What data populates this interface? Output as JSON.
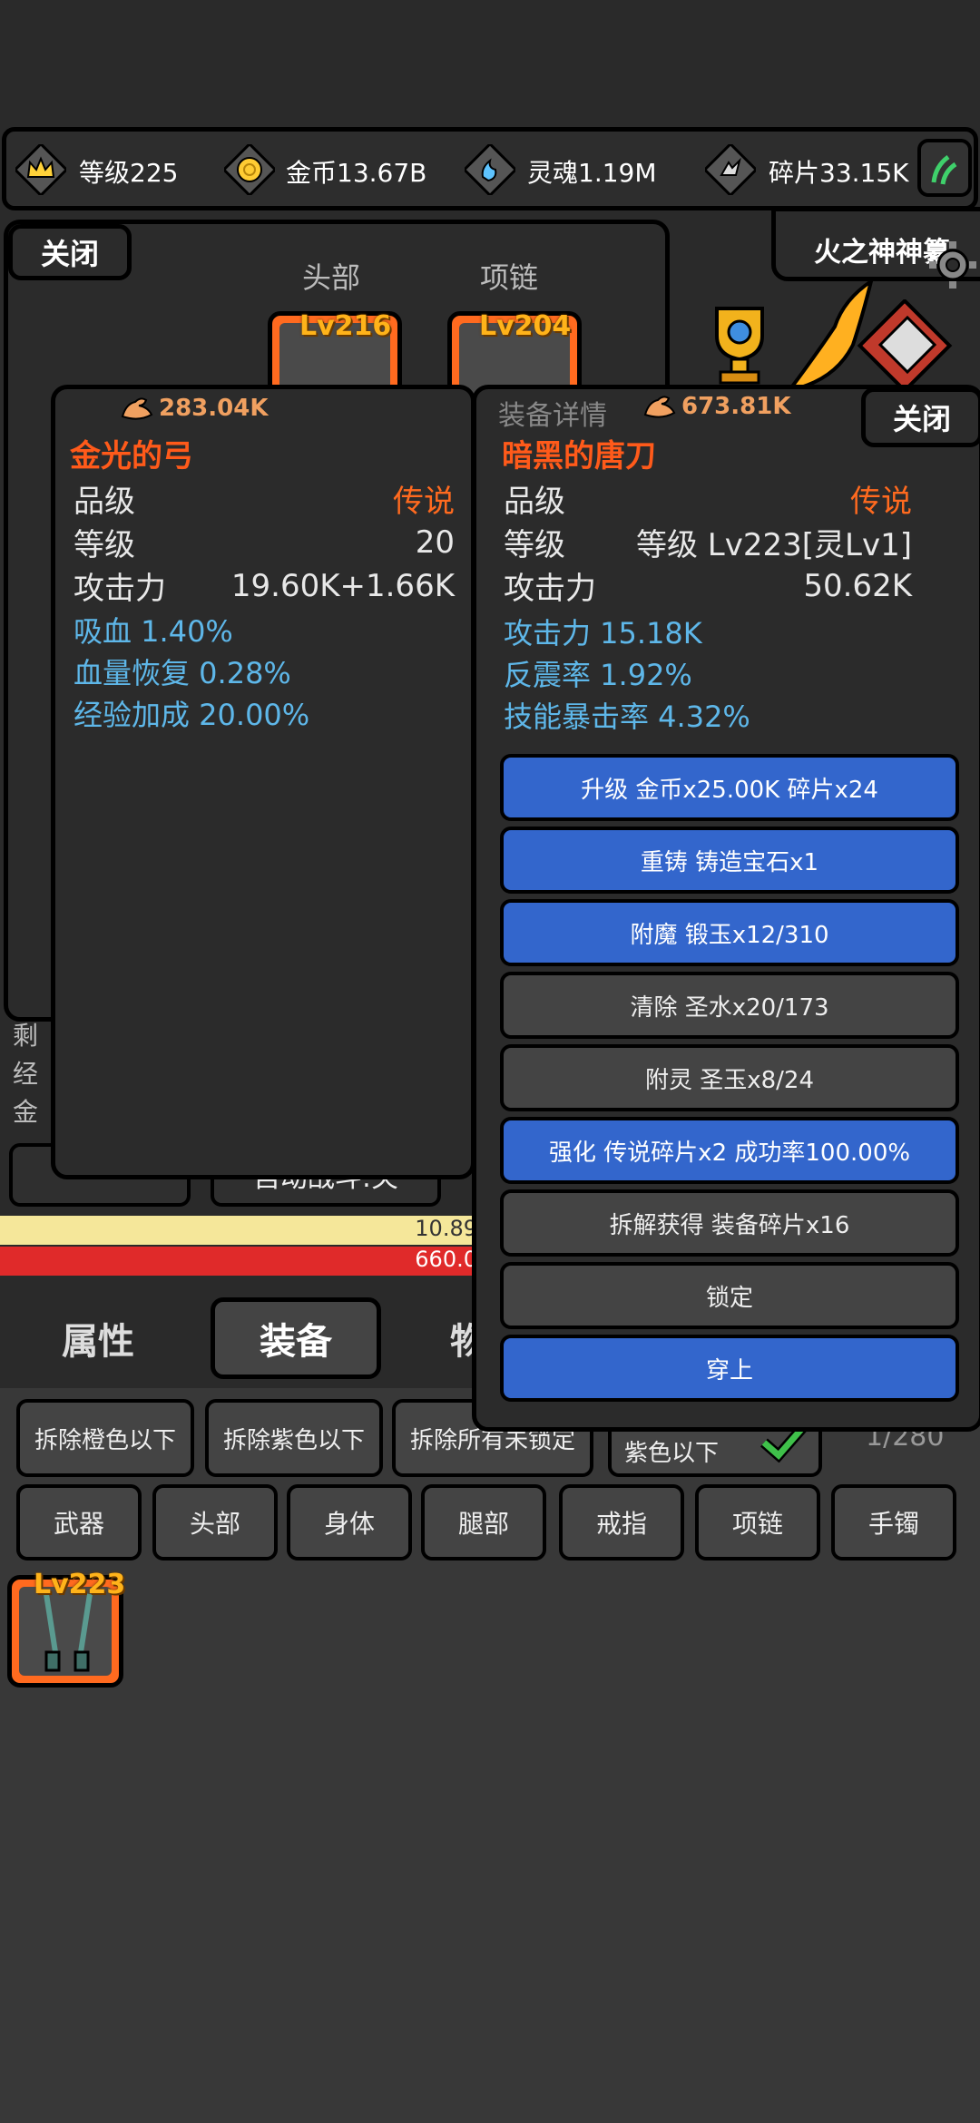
{
  "topbar": {
    "level": "等级225",
    "gold": "金币13.67B",
    "soul": "灵魂1.19M",
    "shards": "碎片33.15K"
  },
  "behind": {
    "close_label": "关闭",
    "slot_head_label": "头部",
    "slot_necklace_label": "项链",
    "slot_head_lv": "Lv216",
    "slot_necklace_lv": "Lv204",
    "fire_god_label": "火之神神纂",
    "left_text": [
      "剩",
      "经",
      "金"
    ],
    "power_yellow": "10.89",
    "power_red": "660.0",
    "btn_left_1": "",
    "btn_left_2": "自动战斗:关"
  },
  "tabs": {
    "attributes": "属性",
    "equipment": "装备",
    "partial": "物"
  },
  "filters": {
    "dismantle_orange": "拆除橙色以下",
    "dismantle_purple": "拆除紫色以下",
    "dismantle_unlocked": "拆除所有未锁定",
    "auto_purple": "紫色以下",
    "count": "1/280"
  },
  "categories": [
    "武器",
    "头部",
    "身体",
    "腿部",
    "戒指",
    "项链",
    "手镯"
  ],
  "inventory": [
    {
      "lv": "Lv223"
    }
  ],
  "compare_card": {
    "power": "283.04K",
    "name": "金光的弓",
    "rows": [
      {
        "label": "品级",
        "value": "传说"
      },
      {
        "label": "等级",
        "value": "20"
      },
      {
        "label": "攻击力",
        "value": "19.60K+1.66K"
      }
    ],
    "stats": [
      "吸血 1.40%",
      "血量恢复 0.28%",
      "经验加成 20.00%"
    ]
  },
  "detail_card": {
    "header": "装备详情",
    "power": "673.81K",
    "close_label": "关闭",
    "name": "暗黑的唐刀",
    "rows": [
      {
        "label": "品级",
        "value": "传说"
      },
      {
        "label": "等级",
        "value": "等级 Lv223[灵Lv1]"
      },
      {
        "label": "攻击力",
        "value": "50.62K"
      }
    ],
    "stats": [
      "攻击力 15.18K",
      "反震率 1.92%",
      "技能暴击率 4.32%"
    ],
    "actions": [
      {
        "label": "升级 金币x25.00K 碎片x24",
        "style": "blue"
      },
      {
        "label": "重铸 铸造宝石x1",
        "style": "blue"
      },
      {
        "label": "附魔 锻玉x12/310",
        "style": "blue"
      },
      {
        "label": "清除 圣水x20/173",
        "style": "dark"
      },
      {
        "label": "附灵 圣玉x8/24",
        "style": "dark"
      },
      {
        "label": "强化 传说碎片x2 成功率100.00%",
        "style": "blue"
      },
      {
        "label": "拆解获得 装备碎片x16",
        "style": "dark"
      },
      {
        "label": "锁定",
        "style": "dark"
      },
      {
        "label": "穿上",
        "style": "blue"
      }
    ]
  },
  "colors": {
    "accent_blue": "#3366cc",
    "legend_orange": "#ff6a1f",
    "stat_blue": "#5eb7e9",
    "level_gold": "#ffb31a"
  }
}
